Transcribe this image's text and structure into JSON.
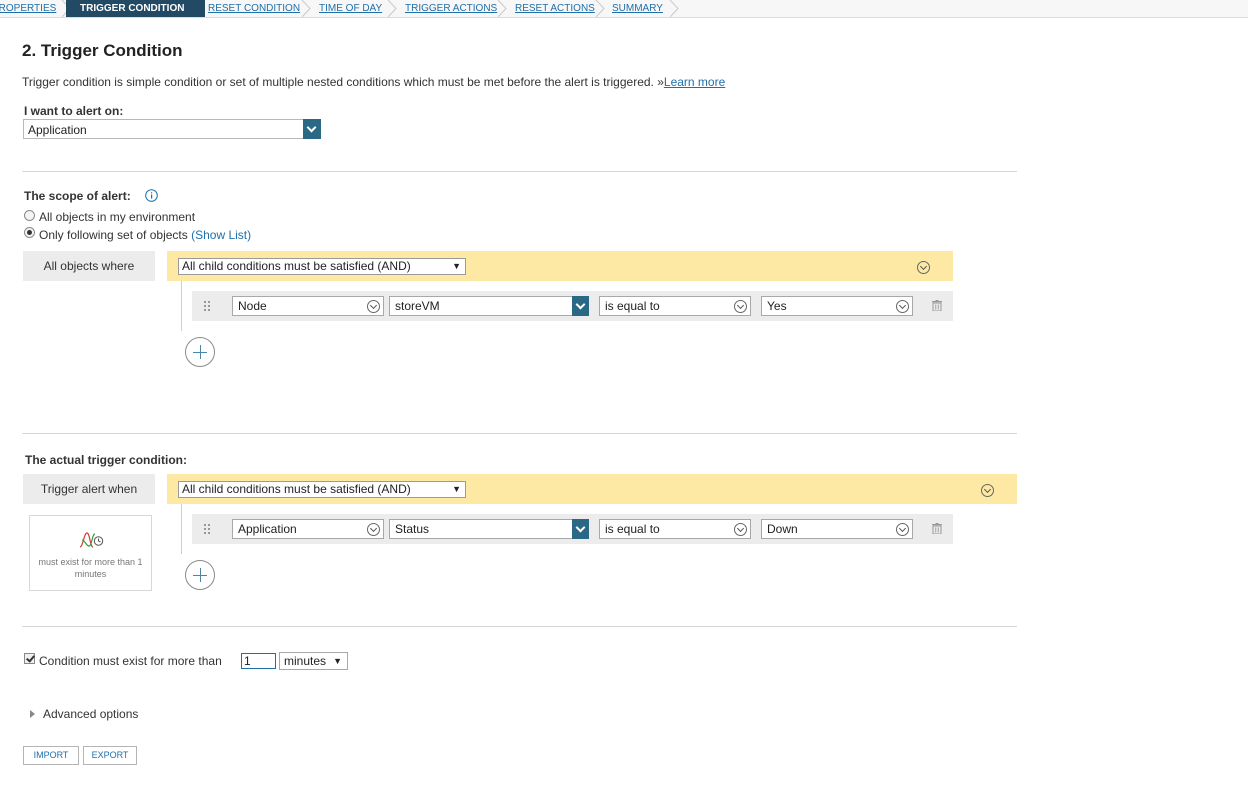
{
  "wizard": {
    "steps": [
      {
        "label": "PROPERTIES"
      },
      {
        "label": "TRIGGER CONDITION"
      },
      {
        "label": "RESET CONDITION"
      },
      {
        "label": "TIME OF DAY"
      },
      {
        "label": "TRIGGER ACTIONS"
      },
      {
        "label": "RESET ACTIONS"
      },
      {
        "label": "SUMMARY"
      }
    ],
    "active_index": 1
  },
  "page": {
    "title": "2. Trigger Condition",
    "description": "Trigger condition is simple condition or set of multiple nested conditions which must be met before the alert is triggered. »",
    "learn_more": "Learn more"
  },
  "alert_on": {
    "label": "I want to alert on:",
    "value": "Application"
  },
  "scope": {
    "label": "The scope of alert:",
    "options": [
      {
        "label": "All objects in my environment",
        "selected": false
      },
      {
        "label": "Only following set of objects",
        "selected": true
      }
    ],
    "show_list": "(Show List)",
    "side_label": "All objects where",
    "group_select": "All child conditions must be satisfied (AND)",
    "condition": {
      "field1": "Node",
      "field2": "storeVM",
      "operator": "is equal to",
      "value": "Yes"
    }
  },
  "trigger": {
    "label": "The actual trigger condition:",
    "side_label": "Trigger alert when",
    "group_select": "All child conditions must be satisfied (AND)",
    "time_note": "must exist for more than 1 minutes",
    "condition": {
      "field1": "Application",
      "field2": "Status",
      "operator": "is equal to",
      "value": "Down"
    }
  },
  "duration": {
    "checked": true,
    "label": "Condition must exist for more than",
    "value": "1",
    "unit": "minutes"
  },
  "advanced": {
    "label": "Advanced options"
  },
  "buttons": {
    "import": "IMPORT",
    "export": "EXPORT"
  },
  "colors": {
    "accent": "#234a64",
    "dropdown_button": "#2a6986",
    "group_bar": "#fde9a4",
    "link": "#1f6fa9"
  }
}
